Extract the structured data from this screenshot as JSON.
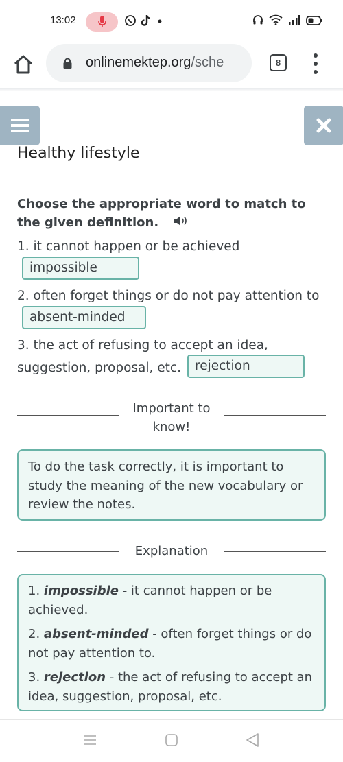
{
  "status_bar": {
    "time": "13:02",
    "icons": [
      "microphone-active-icon",
      "whatsapp-icon",
      "tiktok-icon",
      "notification-dot-icon",
      "headphones-icon",
      "wifi-icon",
      "signal-icon",
      "battery-icon"
    ],
    "mic_color": "#e53946"
  },
  "browser": {
    "url_domain": "onlinemektep.org",
    "url_path": "/sche",
    "tab_count": "8"
  },
  "page": {
    "title": "Healthy lifestyle",
    "instruction": "Choose the appropriate word to match to the given definition.",
    "accent_color": "#69b3a7",
    "button_color": "#9fb4c2",
    "questions": [
      {
        "number": "1.",
        "text": "it cannot happen or be achieved",
        "answer": "impossible"
      },
      {
        "number": "2.",
        "text": "often forget things or do not pay attention to",
        "answer": "absent-minded"
      },
      {
        "number": "3.",
        "text_line1": "the act of refusing to accept an idea,",
        "text_line2": "suggestion, proposal, etc.",
        "answer": "rejection"
      }
    ],
    "important": {
      "heading_line1": "Important to",
      "heading_line2": "know!",
      "text": "To do the task correctly, it is important to study the meaning of the new vocabulary or review the notes."
    },
    "explanation": {
      "heading": "Explanation",
      "items": [
        {
          "number": "1.",
          "term": "impossible",
          "definition": " - it cannot happen or be achieved."
        },
        {
          "number": "2.",
          "term": "absent-minded",
          "definition": " - often forget things or do not pay attention to."
        },
        {
          "number": "3.",
          "term": "rejection",
          "definition": " - the act of refusing to accept an idea, suggestion, proposal, etc."
        }
      ]
    }
  }
}
